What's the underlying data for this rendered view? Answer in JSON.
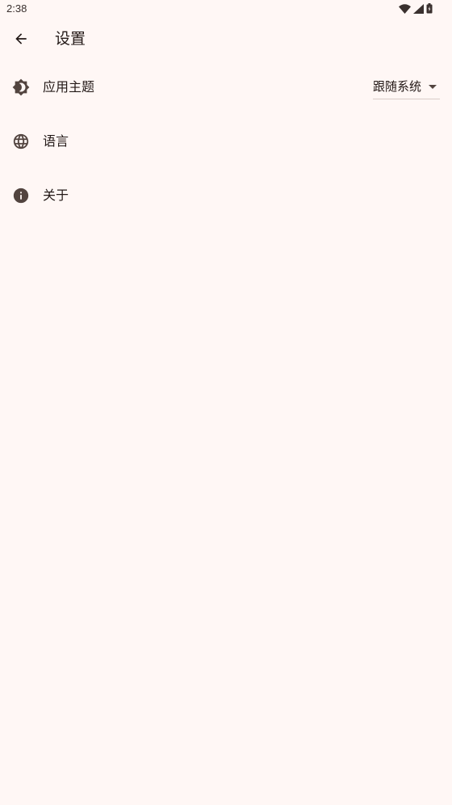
{
  "status_bar": {
    "time": "2:38",
    "icons": [
      "wifi-icon",
      "signal-icon",
      "battery-icon"
    ]
  },
  "app_bar": {
    "back_icon": "arrow-back-icon",
    "title": "设置"
  },
  "settings": [
    {
      "icon": "brightness-icon",
      "label": "应用主题",
      "value": "跟随系统"
    },
    {
      "icon": "globe-icon",
      "label": "语言"
    },
    {
      "icon": "info-icon",
      "label": "关于"
    }
  ],
  "colors": {
    "background": "#FFF7F5",
    "text": "#231917",
    "icon": "#52443f",
    "divider": "#d8cbc8"
  }
}
